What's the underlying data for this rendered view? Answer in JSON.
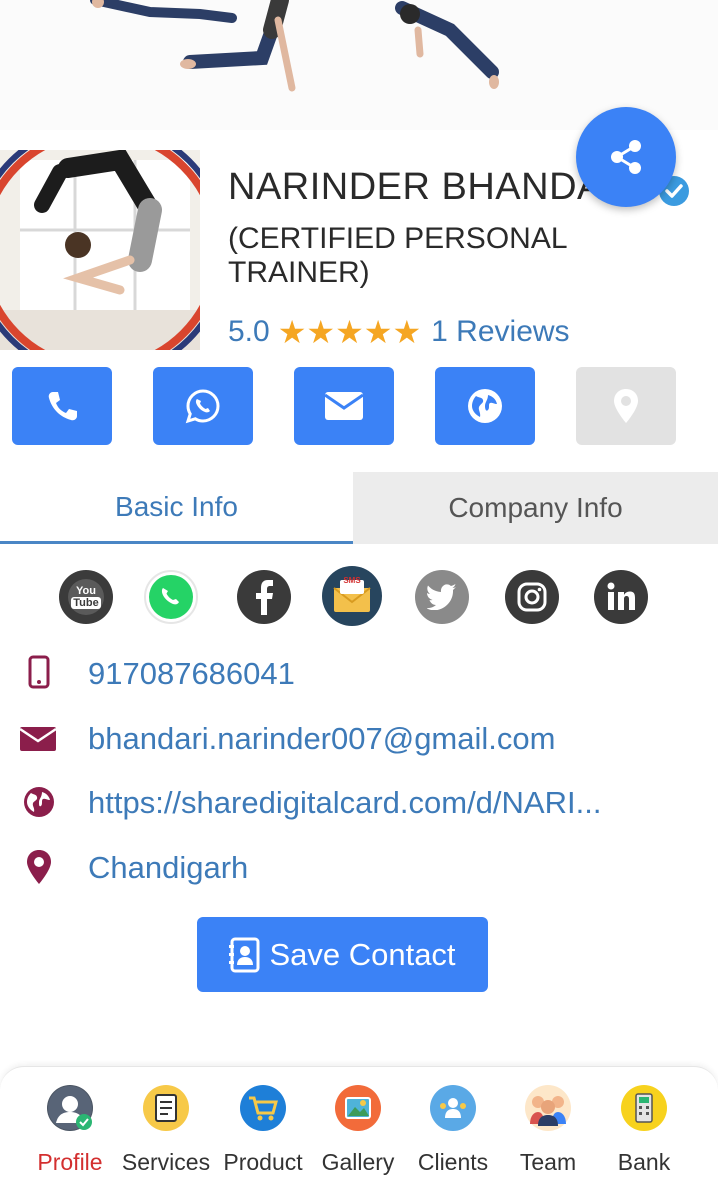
{
  "profile": {
    "name": "NARINDER BHANDA",
    "role": "(CERTIFIED PERSONAL TRAINER)",
    "rating": "5.0",
    "stars": 5,
    "reviews": "1 Reviews"
  },
  "actions": [
    {
      "name": "call",
      "icon": "phone-icon",
      "enabled": true
    },
    {
      "name": "whatsapp",
      "icon": "whatsapp-icon",
      "enabled": true
    },
    {
      "name": "email",
      "icon": "mail-icon",
      "enabled": true
    },
    {
      "name": "website",
      "icon": "globe-icon",
      "enabled": true
    },
    {
      "name": "location",
      "icon": "map-pin-icon",
      "enabled": false
    }
  ],
  "tabs": {
    "basic": "Basic Info",
    "company": "Company Info"
  },
  "social": {
    "youtube_top": "You",
    "youtube_bottom": "Tube",
    "sms": "SMS"
  },
  "contact": {
    "phone": "917087686041",
    "email": "bhandari.narinder007@gmail.com",
    "website": "https://sharedigitalcard.com/d/NARI...",
    "location": "Chandigarh"
  },
  "save_label": "Save Contact",
  "nav": [
    {
      "label": "Profile",
      "icon": "profile-icon",
      "active": true
    },
    {
      "label": "Services",
      "icon": "services-icon",
      "active": false
    },
    {
      "label": "Product",
      "icon": "product-icon",
      "active": false
    },
    {
      "label": "Gallery",
      "icon": "gallery-icon",
      "active": false
    },
    {
      "label": "Clients",
      "icon": "clients-icon",
      "active": false
    },
    {
      "label": "Team",
      "icon": "team-icon",
      "active": false
    },
    {
      "label": "Bank",
      "icon": "bank-icon",
      "active": false
    }
  ],
  "colors": {
    "primary": "#3b82f6",
    "link": "#3d7ab8",
    "accent_icon": "#8b1e4b",
    "star": "#f5a623",
    "active_nav": "#d32f2f"
  }
}
